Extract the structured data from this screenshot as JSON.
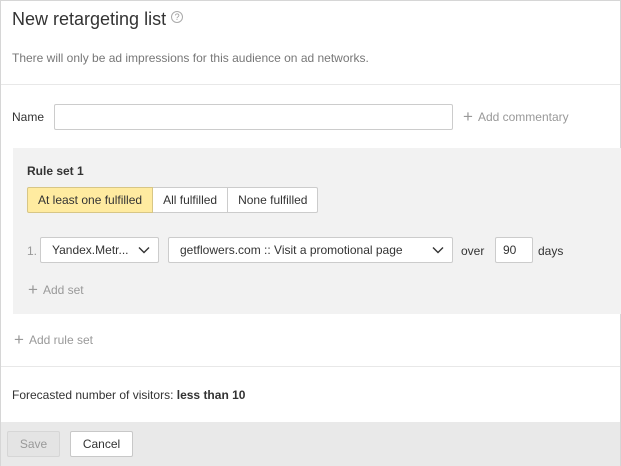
{
  "header": {
    "title": "New retargeting list",
    "help_icon_glyph": "?",
    "subtitle": "There will only be ad impressions for this audience on ad networks."
  },
  "name_field": {
    "label": "Name",
    "value": "",
    "placeholder": ""
  },
  "add_commentary_label": "Add commentary",
  "rule_set": {
    "title": "Rule set 1",
    "modes": [
      "At least one fulfilled",
      "All fulfilled",
      "None fulfilled"
    ],
    "active_mode": "At least one fulfilled",
    "rules": [
      {
        "number": "1.",
        "source": "Yandex.Metr...",
        "goal": "getflowers.com :: Visit a promotional page",
        "over_label": "over",
        "days_value": "90",
        "days_label": "days"
      }
    ],
    "add_set_label": "Add set"
  },
  "add_rule_set_label": "Add rule set",
  "forecast": {
    "label": "Forecasted number of visitors:",
    "value": "less than 10"
  },
  "footer": {
    "save_label": "Save",
    "cancel_label": "Cancel"
  },
  "colors": {
    "active_segment": "#ffeba0",
    "panel_background": "#f2f2f2",
    "footer_background": "#e9e9e9",
    "muted_text": "#999999"
  },
  "icons": {
    "help": "question-circle-icon",
    "plus": "plus-icon",
    "select_arrow": "chevron-down-icon"
  }
}
